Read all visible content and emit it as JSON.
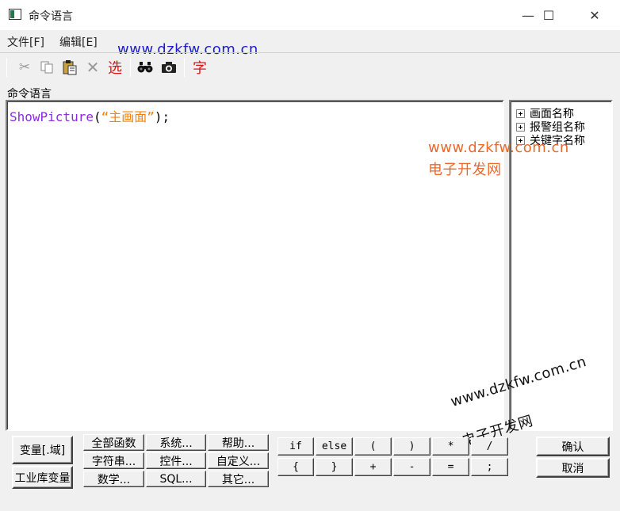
{
  "window": {
    "title": "命令语言",
    "minimize_glyph": "—",
    "maximize_glyph": "☐",
    "close_glyph": "✕"
  },
  "menu": [
    "文件[F]",
    "编辑[E]"
  ],
  "toolbar": {
    "select_glyph": "选",
    "font_glyph": "字",
    "icons": [
      "scissors-icon",
      "copy-icon",
      "paste-icon",
      "delete-icon",
      "select-icon",
      "binoculars-icon",
      "camera-icon",
      "font-icon"
    ]
  },
  "watermarks": {
    "top": "www.dzkfw.com.cn",
    "mid_url": "www.dzkfw.com.cn",
    "mid_cn": "电子开发网",
    "low_url": "www.dzkfw.com.cn",
    "low_cn": "电子开发网"
  },
  "editor": {
    "label": "命令语言",
    "code": {
      "func": "ShowPicture",
      "open": "(",
      "string": "“主画面”",
      "close": ");"
    }
  },
  "tree": {
    "items": [
      "画面名称",
      "报警组名称",
      "关键字名称"
    ]
  },
  "buttons": {
    "variable": "变量[.域]",
    "io_variable": "工业库变量",
    "all_functions": "全部函数",
    "system": "系统...",
    "help": "帮助...",
    "string": "字符串...",
    "control": "控件...",
    "custom": "自定义...",
    "math": "数学...",
    "sql": "SQL...",
    "other": "其它...",
    "ops": [
      "if",
      "else",
      "(",
      ")",
      "*",
      "/",
      "{",
      "}",
      "+",
      "-",
      "=",
      ";"
    ],
    "ok": "确认",
    "cancel": "取消"
  }
}
